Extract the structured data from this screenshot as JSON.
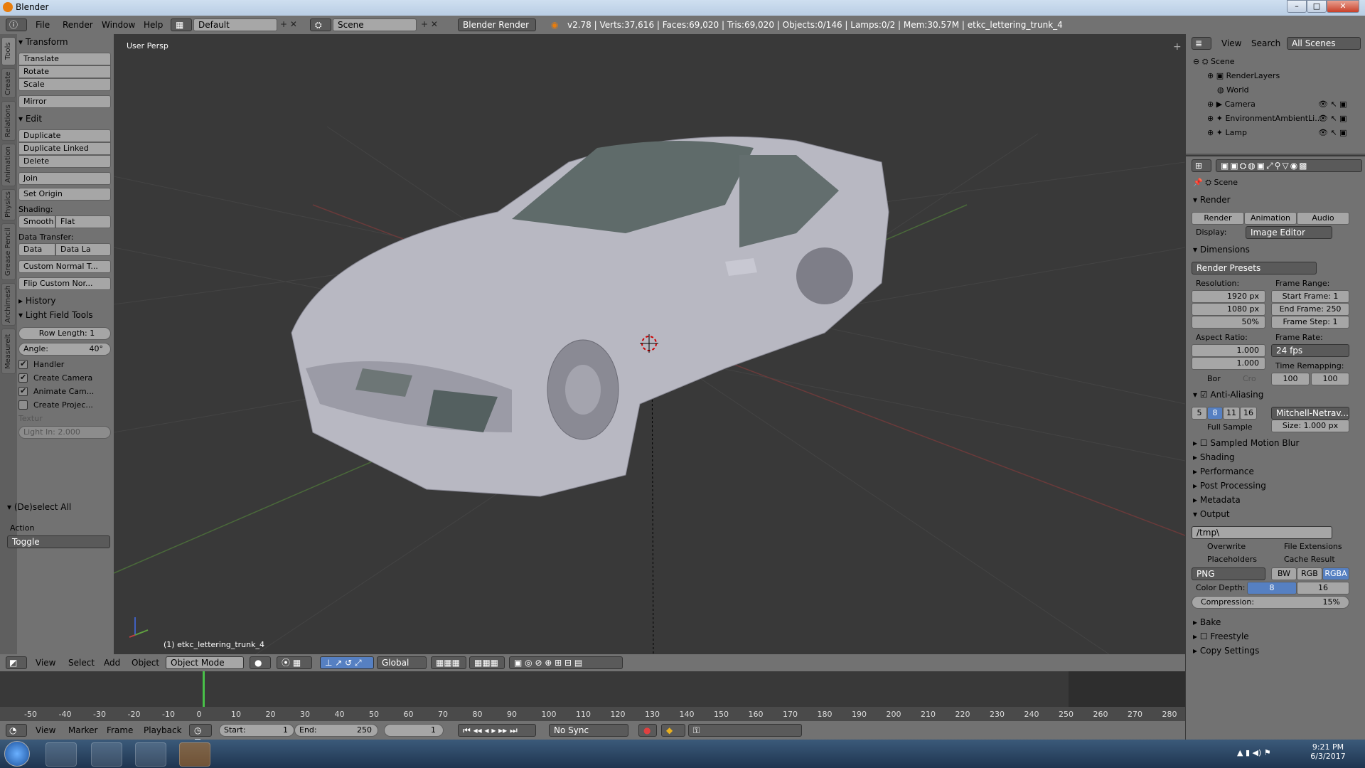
{
  "window": {
    "title": "Blender",
    "min": "–",
    "max": "□",
    "close": "✕"
  },
  "menu": {
    "items": [
      "File",
      "Render",
      "Window",
      "Help"
    ],
    "layout": "Default",
    "scene": "Scene",
    "engine": "Blender Render"
  },
  "info_text": "v2.78 | Verts:37,616 | Faces:69,020 | Tris:69,020 | Objects:0/146 | Lamps:0/2 | Mem:30.57M | etkc_lettering_trunk_4",
  "toolshelf": {
    "tabs": [
      "Tools",
      "Create",
      "Relations",
      "Animation",
      "Physics",
      "Grease Pencil",
      "Archimesh",
      "Measureit"
    ],
    "transform_header": "Transform",
    "transform": [
      "Translate",
      "Rotate",
      "Scale"
    ],
    "mirror": "Mirror",
    "edit_header": "Edit",
    "edit": [
      "Duplicate",
      "Duplicate Linked",
      "Delete"
    ],
    "join": "Join",
    "set_origin": "Set Origin",
    "shading_label": "Shading:",
    "smooth": "Smooth",
    "flat": "Flat",
    "data_transfer_label": "Data Transfer:",
    "data": "Data",
    "data_la": "Data La",
    "custom_normal": "Custom Normal T...",
    "flip_custom": "Flip Custom Nor...",
    "history": "History",
    "light_field": "Light Field Tools",
    "row_length": "Row Length: 1",
    "angle_label": "Angle:",
    "angle_value": "40°",
    "handler": "Handler",
    "create_camera": "Create Camera",
    "animate_cam": "Animate Cam...",
    "create_proj": "Create Projec...",
    "textur": "Textur",
    "light_in": "Light In: 2.000",
    "deselect": "(De)select All",
    "action": "Action",
    "toggle": "Toggle"
  },
  "viewport": {
    "persp": "User Persp",
    "object_label": "(1) etkc_lettering_trunk_4"
  },
  "view_header": {
    "items": [
      "View",
      "Select",
      "Add",
      "Object"
    ],
    "mode": "Object Mode",
    "orientation": "Global"
  },
  "timeline": {
    "ticks": [
      "-50",
      "-40",
      "-30",
      "-20",
      "-10",
      "0",
      "10",
      "20",
      "30",
      "40",
      "50",
      "60",
      "70",
      "80",
      "90",
      "100",
      "110",
      "120",
      "130",
      "140",
      "150",
      "160",
      "170",
      "180",
      "190",
      "200",
      "210",
      "220",
      "230",
      "240",
      "250",
      "260",
      "270",
      "280"
    ],
    "menu": [
      "View",
      "Marker",
      "Frame",
      "Playback"
    ],
    "start": "Start:",
    "start_val": "1",
    "end": "End:",
    "end_val": "250",
    "current": "1",
    "sync": "No Sync"
  },
  "outliner": {
    "menu": [
      "View",
      "Search"
    ],
    "filter": "All Scenes",
    "items": [
      "Scene",
      "RenderLayers",
      "World",
      "Camera",
      "EnvironmentAmbientLi...",
      "Lamp"
    ]
  },
  "properties": {
    "context": "Scene",
    "render_header": "Render",
    "render_btn": "Render",
    "animation_btn": "Animation",
    "audio_btn": "Audio",
    "display_label": "Display:",
    "display_value": "Image Editor",
    "dimensions": "Dimensions",
    "presets": "Render Presets",
    "resolution": "Resolution:",
    "res_x": "1920 px",
    "res_y": "1080 px",
    "res_pct": "50%",
    "frame_range": "Frame Range:",
    "start_frame": "Start Frame: 1",
    "end_frame": "End Frame: 250",
    "frame_step": "Frame Step: 1",
    "aspect": "Aspect Ratio:",
    "asp_x": "1.000",
    "asp_y": "1.000",
    "bor": "Bor",
    "cro": "Cro",
    "frame_rate": "Frame Rate:",
    "fps": "24 fps",
    "time_remap": "Time Remapping:",
    "remap_a": "100",
    "remap_b": "100",
    "anti_aliasing": "Anti-Aliasing",
    "aa_levels": [
      "5",
      "8",
      "11",
      "16"
    ],
    "aa_filter": "Mitchell-Netrav...",
    "full_sample": "Full Sample",
    "size": "Size: 1.000 px",
    "sampled_motion_blur": "Sampled Motion Blur",
    "shading": "Shading",
    "performance": "Performance",
    "post_processing": "Post Processing",
    "metadata": "Metadata",
    "output": "Output",
    "path": "/tmp\\",
    "overwrite": "Overwrite",
    "file_ext": "File Extensions",
    "placeholders": "Placeholders",
    "cache": "Cache Result",
    "format": "PNG",
    "bw": "BW",
    "rgb": "RGB",
    "rgba": "RGBA",
    "color_depth": "Color Depth:",
    "depth8": "8",
    "depth16": "16",
    "compression": "Compression:",
    "comp_val": "15%",
    "bake": "Bake",
    "freestyle": "Freestyle",
    "copy_settings": "Copy Settings"
  },
  "taskbar": {
    "time": "9:21 PM",
    "date": "6/3/2017"
  },
  "colors": {
    "accent": "#5680c2",
    "blender_orange": "#e87d0d"
  }
}
